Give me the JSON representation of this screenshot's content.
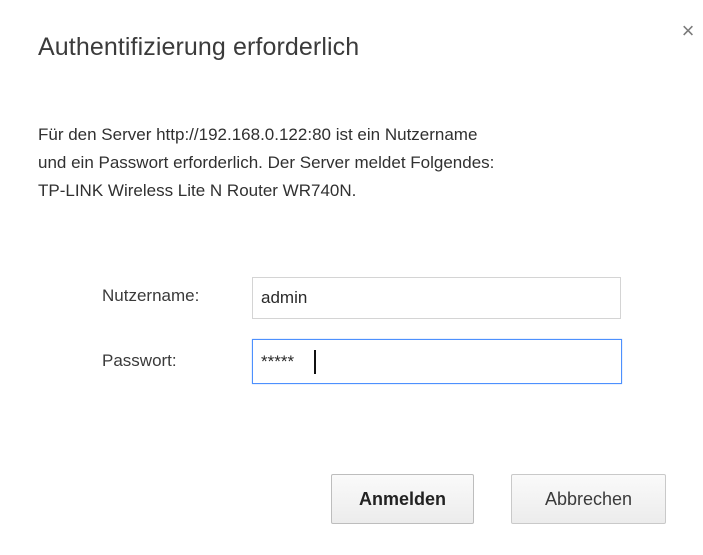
{
  "dialog": {
    "title": "Authentifizierung erforderlich",
    "close_symbol": "×",
    "message_lines": [
      "Für den Server http://192.168.0.122:80 ist ein Nutzername",
      "und ein Passwort erforderlich. Der Server meldet Folgendes:",
      "TP-LINK Wireless Lite N Router WR740N."
    ]
  },
  "form": {
    "username_label": "Nutzername:",
    "username_value": "admin",
    "password_label": "Passwort:",
    "password_value": "*****"
  },
  "buttons": {
    "login_label": "Anmelden",
    "cancel_label": "Abbrechen"
  },
  "icons": {
    "close": "close-icon"
  },
  "colors": {
    "focus_border": "#4d90fe",
    "text": "#333333"
  }
}
